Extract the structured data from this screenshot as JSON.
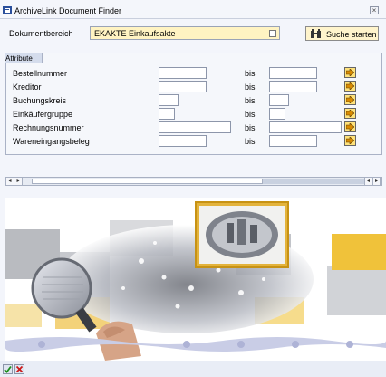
{
  "window": {
    "title": "ArchiveLink Document Finder"
  },
  "header": {
    "dokumentbereich_label": "Dokumentbereich",
    "dokumentbereich_value": "EKAKTE Einkaufsakte",
    "search_button_label": "Suche starten"
  },
  "attributes": {
    "tab_label": "Attribute",
    "to_label": "bis",
    "rows": [
      {
        "label": "Bestellnummer",
        "from": "",
        "to": ""
      },
      {
        "label": "Kreditor",
        "from": "",
        "to": ""
      },
      {
        "label": "Buchungskreis",
        "from": "",
        "to": ""
      },
      {
        "label": "Einkäufergruppe",
        "from": "",
        "to": ""
      },
      {
        "label": "Rechnungsnummer",
        "from": "",
        "to": ""
      },
      {
        "label": "Wareneingangsbeleg",
        "from": "",
        "to": ""
      }
    ]
  },
  "icons": {
    "title": "window-icon",
    "close": "close-icon",
    "help": "value-help-icon",
    "search": "binoculars-icon",
    "multiple_selection": "arrow-right-icon",
    "ok": "checkmark-icon",
    "cancel": "cancel-x-icon"
  },
  "colors": {
    "required_field": "#fff3c2",
    "button_yellow": "#ffe27a",
    "banner_accent": "#f0c23a"
  }
}
